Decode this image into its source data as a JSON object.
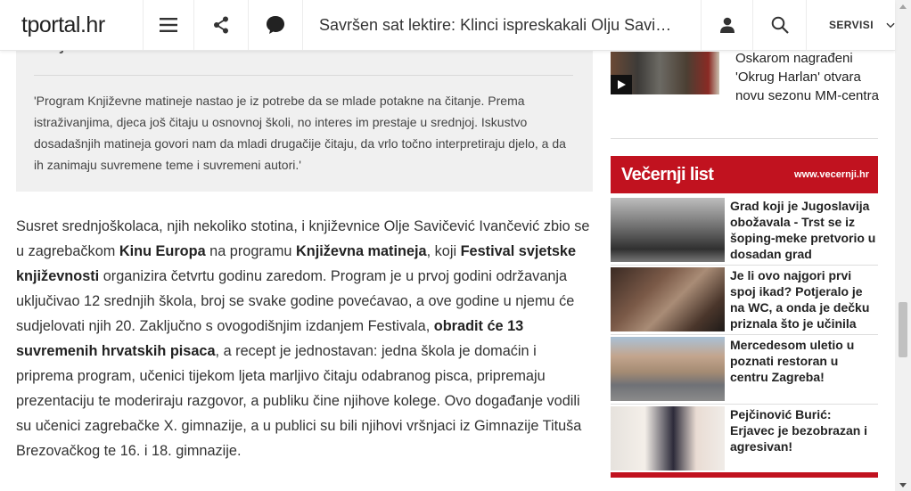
{
  "header": {
    "logo_text": "tportal",
    "logo_suffix": ".hr",
    "headline": "Savršen sat lektire: Klinci ispreskakali Olju Savi…",
    "servisi_label": "SERVISI"
  },
  "quote": {
    "title": "Književnosti",
    "text": "'Program Književne matineje nastao je iz potrebe da se mlade potakne na čitanje. Prema istraživanjima, djeca još čitaju u osnovnoj školi, no interes im prestaje u srednjoj. Iskustvo dosadašnjih matineja govori nam da mladi drugačije čitaju, da vrlo točno interpretiraju djelo, a da ih zanimaju suvremene teme i suvremeni autori.'"
  },
  "article": {
    "p1": "Susret srednjoškolaca, njih nekoliko stotina, i književnice Olje Savičević Ivančević zbio se u zagrebačkom ",
    "b1": "Kinu Europa",
    "p2": " na programu ",
    "b2": "Književna matineja",
    "p3": ", koji ",
    "b3": "Festival svjetske književnosti",
    "p4": " organizira četvrtu godinu zaredom. Program je u prvoj godini održavanja uključivao 12 srednjih škola, broj se svake godine povećavao, a ove godine u njemu će sudjelovati njih 20. Zaključno s ovogodišnjim izdanjem Festivala, ",
    "b4": "obradit će 13 suvremenih hrvatskih pisaca",
    "p5": ", a recept je jednostavan: jedna škola je domaćin i priprema program, učenici tijekom ljeta marljivo čitaju odabranog pisca, pripremaju prezentaciju te moderiraju razgovor, a publiku čine njihove kolege. Ovo događanje vodili su učenici zagrebačke X. gimnazije, a u publici su bili njihovi vršnjaci iz Gimnazije Tituša Brezovačkog te 16. i 18. gimnazije."
  },
  "related": {
    "title": "Oskarom nagrađeni 'Okrug Harlan' otvara novu sezonu MM-centra"
  },
  "vecernji": {
    "logo": "Večernji list",
    "url": "www.vecernji.hr",
    "items": [
      {
        "title": "Grad koji je Jugoslavija obožavala - Trst se iz šoping-meke pretvorio u dosadan grad"
      },
      {
        "title": "Je li ovo najgori prvi spoj ikad? Potjeralo je na WC, a onda je dečku priznala što je učinila"
      },
      {
        "title": "Mercedesom uletio u poznati restoran u centru Zagreba!"
      },
      {
        "title": "Pejčinović Burić: Erjavec je bezobrazan i agresivan!"
      }
    ]
  },
  "icons": {
    "menu": "hamburger-icon",
    "share": "share-icon",
    "comment": "comment-icon",
    "user": "user-icon",
    "search": "search-icon",
    "chevron": "chevron-down-icon",
    "play": "play-icon"
  },
  "colors": {
    "accent": "#c1121f",
    "quote_bg": "#f0f0f0"
  }
}
